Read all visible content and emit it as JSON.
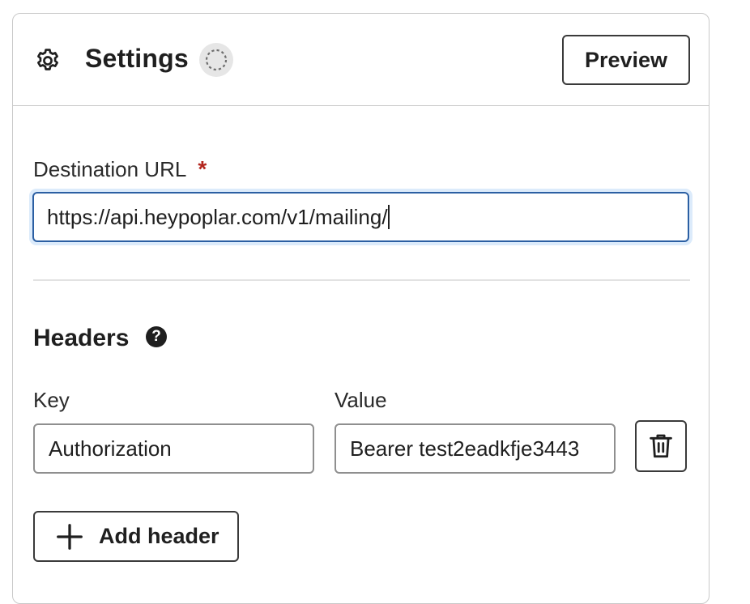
{
  "header": {
    "title": "Settings",
    "preview_label": "Preview",
    "icon": "gear-icon",
    "status_icon": "loading-spinner-icon"
  },
  "destination": {
    "label": "Destination URL",
    "required_marker": "*",
    "value": "https://api.heypoplar.com/v1/mailing/"
  },
  "headers_section": {
    "title": "Headers",
    "help_glyph": "?",
    "key_label": "Key",
    "value_label": "Value",
    "rows": [
      {
        "key": "Authorization",
        "value": "Bearer test2eadkfje3443"
      }
    ],
    "add_label": "Add header"
  },
  "colors": {
    "required": "#b3261e",
    "focus_border": "#2b5fa3",
    "focus_ring": "#dcebfb"
  }
}
